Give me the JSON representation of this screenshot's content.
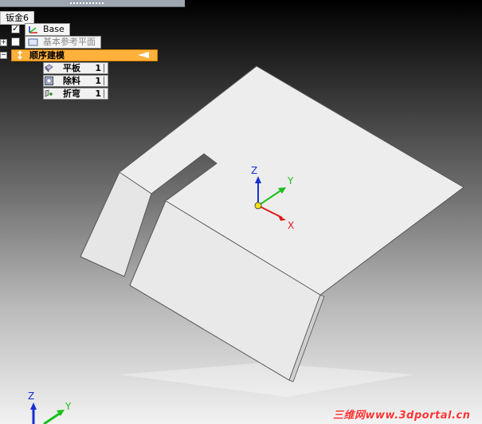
{
  "tree": {
    "root": "钣金6",
    "base": "Base",
    "ref_planes": "基本参考平面",
    "ordered": "顺序建模",
    "features": [
      {
        "name": "平板",
        "count": "1",
        "icon": "tab-icon"
      },
      {
        "name": "除料",
        "count": "1",
        "icon": "cutout-icon"
      },
      {
        "name": "折弯",
        "count": "1",
        "icon": "flange-icon"
      }
    ]
  },
  "triad": {
    "x": "X",
    "y": "Y",
    "z": "Z"
  },
  "watermark": "三维网www.3dportal.cn",
  "colors": {
    "ordered_highlight": "#ffb13b",
    "axis_x": "#e01818",
    "axis_y": "#18c018",
    "axis_z": "#1830d0"
  }
}
